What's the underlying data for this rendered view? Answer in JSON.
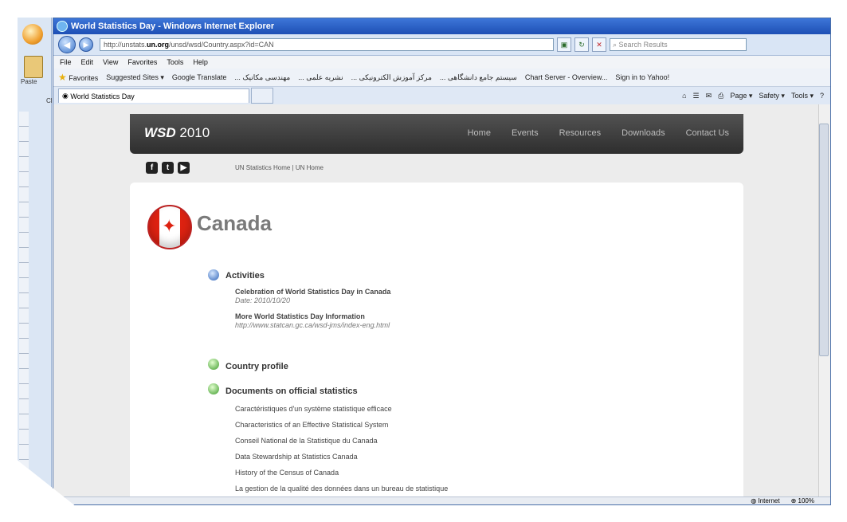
{
  "office": {
    "paste_label": "Paste",
    "clip_label": "Cli"
  },
  "browser": {
    "title": "World Statistics Day - Windows Internet Explorer",
    "url_prefix": "http://unstats.",
    "url_domain": "un.org",
    "url_suffix": "/unsd/wsd/Country.aspx?id=CAN",
    "search_placeholder": "Search Results",
    "menu": [
      "File",
      "Edit",
      "View",
      "Favorites",
      "Tools",
      "Help"
    ],
    "favorites_label": "Favorites",
    "favorites": [
      "Suggested Sites ▾",
      "Google Translate",
      "... مهندسی مکانیک",
      "... نشریه علمی",
      "... مرکز آموزش الکترونیکی",
      "... سیستم جامع دانشگاهی",
      "Chart Server - Overview...",
      "Sign in to Yahoo!"
    ],
    "tab_title": "World Statistics Day",
    "commands": [
      "Page ▾",
      "Safety ▾",
      "Tools ▾"
    ],
    "status": {
      "zone": "Internet",
      "zoom": "100%"
    }
  },
  "site": {
    "logo_a": "WSD",
    "logo_b": " 2010",
    "nav": [
      "Home",
      "Events",
      "Resources",
      "Downloads",
      "Contact Us"
    ],
    "social": [
      "f",
      "t",
      "▶"
    ],
    "toplinks": "UN Statistics Home  | UN Home"
  },
  "country": {
    "name": "Canada"
  },
  "activities": {
    "title": "Activities",
    "item1_title": "Celebration of World Statistics Day in Canada",
    "item1_date": "Date: 2010/10/20",
    "item2_title": "More World Statistics Day Information",
    "item2_url": "http://www.statcan.gc.ca/wsd-jms/index-eng.html"
  },
  "profile": {
    "title": "Country profile"
  },
  "documents": {
    "title": "Documents on official statistics",
    "items": [
      "Caractéristiques d'un système statistique efficace",
      "Characteristics of an Effective Statistical System",
      "Conseil National de la Statistique du Canada",
      "Data Stewardship at Statistics Canada",
      "History of the Census of Canada",
      "La gestion de la qualité des données dans un bureau de statistique"
    ]
  }
}
